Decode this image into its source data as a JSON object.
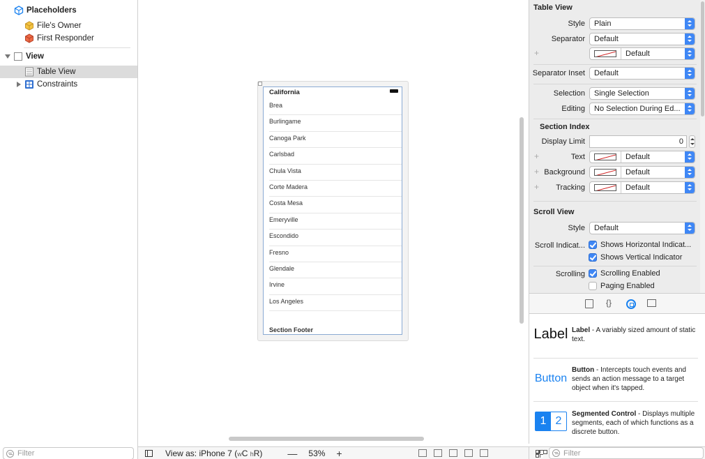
{
  "outline": {
    "placeholders": "Placeholders",
    "files_owner": "File's Owner",
    "first_responder": "First Responder",
    "view": "View",
    "table_view": "Table View",
    "constraints": "Constraints",
    "filter_placeholder": "Filter"
  },
  "canvas": {
    "section_header": "California",
    "rows": [
      "Brea",
      "Burlingame",
      "Canoga Park",
      "Carlsbad",
      "Chula Vista",
      "Corte Madera",
      "Costa Mesa",
      "Emeryville",
      "Escondido",
      "Fresno",
      "Glendale",
      "Irvine",
      "Los Angeles"
    ],
    "section_footer": "Section Footer"
  },
  "bottombar": {
    "view_as": "View as: iPhone 7",
    "size_class_open": "(",
    "size_w": "w",
    "size_c": "C",
    "size_h": "h",
    "size_r": "R)",
    "zoom_out": "—",
    "zoom": "53%",
    "zoom_in": "+"
  },
  "inspector": {
    "table_view_title": "Table View",
    "style_label": "Style",
    "style_value": "Plain",
    "separator_label": "Separator",
    "separator_value": "Default",
    "separator_color_value": "Default",
    "separator_inset_label": "Separator Inset",
    "separator_inset_value": "Default",
    "selection_label": "Selection",
    "selection_value": "Single Selection",
    "editing_label": "Editing",
    "editing_value": "No Selection During Ed...",
    "section_index_title": "Section Index",
    "display_limit_label": "Display Limit",
    "display_limit_value": "0",
    "text_label": "Text",
    "text_value": "Default",
    "background_label": "Background",
    "background_value": "Default",
    "tracking_label": "Tracking",
    "tracking_value": "Default",
    "scroll_view_title": "Scroll View",
    "scroll_style_label": "Style",
    "scroll_style_value": "Default",
    "scroll_indicators_label": "Scroll Indicat...",
    "shows_horizontal": "Shows Horizontal Indicat...",
    "shows_vertical": "Shows Vertical Indicator",
    "scrolling_label": "Scrolling",
    "scrolling_enabled": "Scrolling Enabled",
    "paging_enabled": "Paging Enabled",
    "plus": "+"
  },
  "library": {
    "tab_braces": "{}",
    "items": [
      {
        "icon_text": "Label",
        "name": "Label",
        "desc": " - A variably sized amount of static text."
      },
      {
        "icon_text": "Button",
        "name": "Button",
        "desc": " - Intercepts touch events and sends an action message to a target object when it's tapped."
      },
      {
        "icon_text_1": "1",
        "icon_text_2": "2",
        "name": "Segmented Control",
        "desc": " - Displays multiple segments, each of which functions as a discrete button."
      }
    ],
    "filter_placeholder": "Filter"
  },
  "colors": {
    "accent": "#3f87f5",
    "selection_bg": "#dcdcdc",
    "tableview_border": "#8aaad3"
  }
}
